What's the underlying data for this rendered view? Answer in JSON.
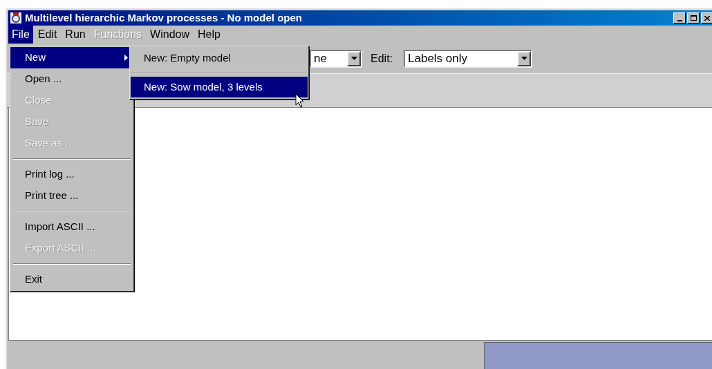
{
  "window": {
    "title": "Multilevel hierarchic Markov processes - No model open"
  },
  "menubar": [
    {
      "label": "File",
      "selected": true,
      "disabled": false
    },
    {
      "label": "Edit",
      "selected": false,
      "disabled": false
    },
    {
      "label": "Run",
      "selected": false,
      "disabled": false
    },
    {
      "label": "Functions",
      "selected": false,
      "disabled": true
    },
    {
      "label": "Window",
      "selected": false,
      "disabled": false
    },
    {
      "label": "Help",
      "selected": false,
      "disabled": false
    }
  ],
  "toolbar": {
    "view_combo": "ne",
    "edit_label": "Edit:",
    "edit_combo": "Labels only"
  },
  "file_menu": [
    {
      "kind": "item",
      "label": "New",
      "selected": true,
      "disabled": false,
      "submenu": true
    },
    {
      "kind": "item",
      "label": "Open ...",
      "selected": false,
      "disabled": false,
      "submenu": false
    },
    {
      "kind": "item",
      "label": "Close",
      "selected": false,
      "disabled": true,
      "submenu": false
    },
    {
      "kind": "item",
      "label": "Save",
      "selected": false,
      "disabled": true,
      "submenu": false
    },
    {
      "kind": "item",
      "label": "Save as ...",
      "selected": false,
      "disabled": true,
      "submenu": false
    },
    {
      "kind": "separator"
    },
    {
      "kind": "item",
      "label": "Print log ...",
      "selected": false,
      "disabled": false,
      "submenu": false
    },
    {
      "kind": "item",
      "label": "Print tree ...",
      "selected": false,
      "disabled": false,
      "submenu": false
    },
    {
      "kind": "separator"
    },
    {
      "kind": "item",
      "label": "Import ASCII ...",
      "selected": false,
      "disabled": false,
      "submenu": false
    },
    {
      "kind": "item",
      "label": "Export ASCII ...",
      "selected": false,
      "disabled": true,
      "submenu": false
    },
    {
      "kind": "separator"
    },
    {
      "kind": "item",
      "label": "Exit",
      "selected": false,
      "disabled": false,
      "submenu": false
    }
  ],
  "new_submenu": [
    {
      "kind": "item",
      "label": "New: Empty model",
      "selected": false
    },
    {
      "kind": "separator"
    },
    {
      "kind": "item",
      "label": "New: Sow model, 3 levels",
      "selected": true
    }
  ]
}
